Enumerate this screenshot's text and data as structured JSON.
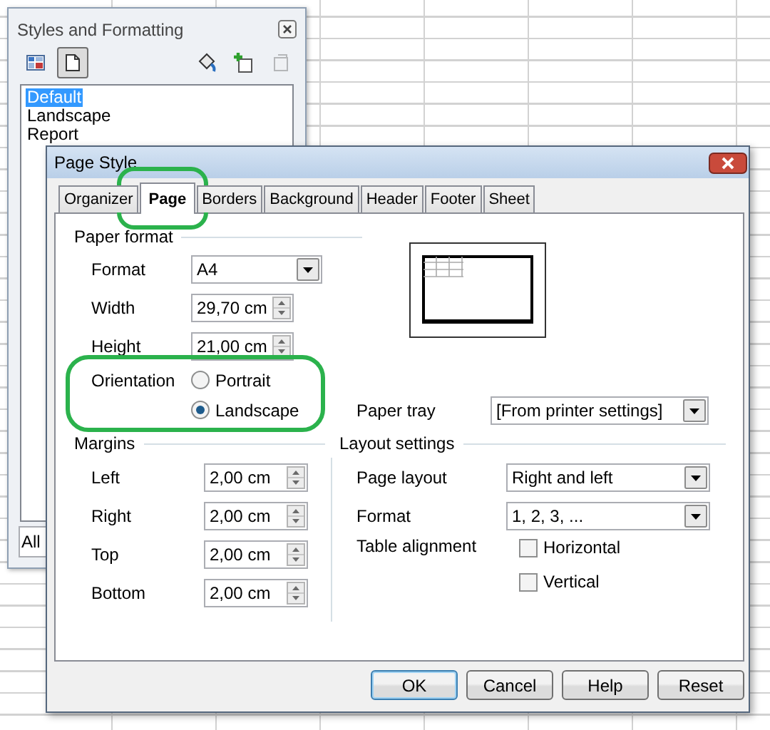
{
  "styles_panel": {
    "title": "Styles and Formatting",
    "families": [
      {
        "kind": "cell",
        "selected": false
      },
      {
        "kind": "page",
        "selected": true
      }
    ],
    "actions": [
      {
        "kind": "fill",
        "disabled": false
      },
      {
        "kind": "new",
        "disabled": false
      },
      {
        "kind": "update",
        "disabled": true
      }
    ],
    "styles": [
      {
        "label": "Default",
        "selected": true
      },
      {
        "label": "Landscape",
        "selected": false
      },
      {
        "label": "Report",
        "selected": false
      }
    ],
    "filter": "All"
  },
  "dialog": {
    "title": "Page Style",
    "tabs": [
      {
        "label": "Organizer",
        "selected": false
      },
      {
        "label": "Page",
        "selected": true
      },
      {
        "label": "Borders",
        "selected": false
      },
      {
        "label": "Background",
        "selected": false
      },
      {
        "label": "Header",
        "selected": false
      },
      {
        "label": "Footer",
        "selected": false
      },
      {
        "label": "Sheet",
        "selected": false
      }
    ],
    "paper_format": {
      "heading": "Paper format",
      "fields": [
        {
          "kind": "combo",
          "label": "Format",
          "value": "A4"
        },
        {
          "kind": "spin",
          "label": "Width",
          "value": "29,70 cm"
        },
        {
          "kind": "spin",
          "label": "Height",
          "value": "21,00 cm"
        }
      ],
      "orientation": {
        "label": "Orientation",
        "options": [
          {
            "label": "Portrait",
            "selected": false
          },
          {
            "label": "Landscape",
            "selected": true
          }
        ]
      },
      "paper_tray": {
        "label": "Paper tray",
        "value": "[From printer settings]"
      }
    },
    "margins": {
      "heading": "Margins",
      "fields": [
        {
          "label": "Left",
          "value": "2,00 cm"
        },
        {
          "label": "Right",
          "value": "2,00 cm"
        },
        {
          "label": "Top",
          "value": "2,00 cm"
        },
        {
          "label": "Bottom",
          "value": "2,00 cm"
        }
      ]
    },
    "layout_settings": {
      "heading": "Layout settings",
      "fields": [
        {
          "label": "Page layout",
          "value": "Right and left"
        },
        {
          "label": "Format",
          "value": "1, 2, 3, ..."
        }
      ],
      "table_alignment": {
        "label": "Table alignment",
        "options": [
          {
            "label": "Horizontal",
            "checked": false
          },
          {
            "label": "Vertical",
            "checked": false
          }
        ]
      }
    },
    "buttons": [
      {
        "label": "OK",
        "default": true
      },
      {
        "label": "Cancel",
        "default": false
      },
      {
        "label": "Help",
        "default": false
      },
      {
        "label": "Reset",
        "default": false
      }
    ]
  }
}
